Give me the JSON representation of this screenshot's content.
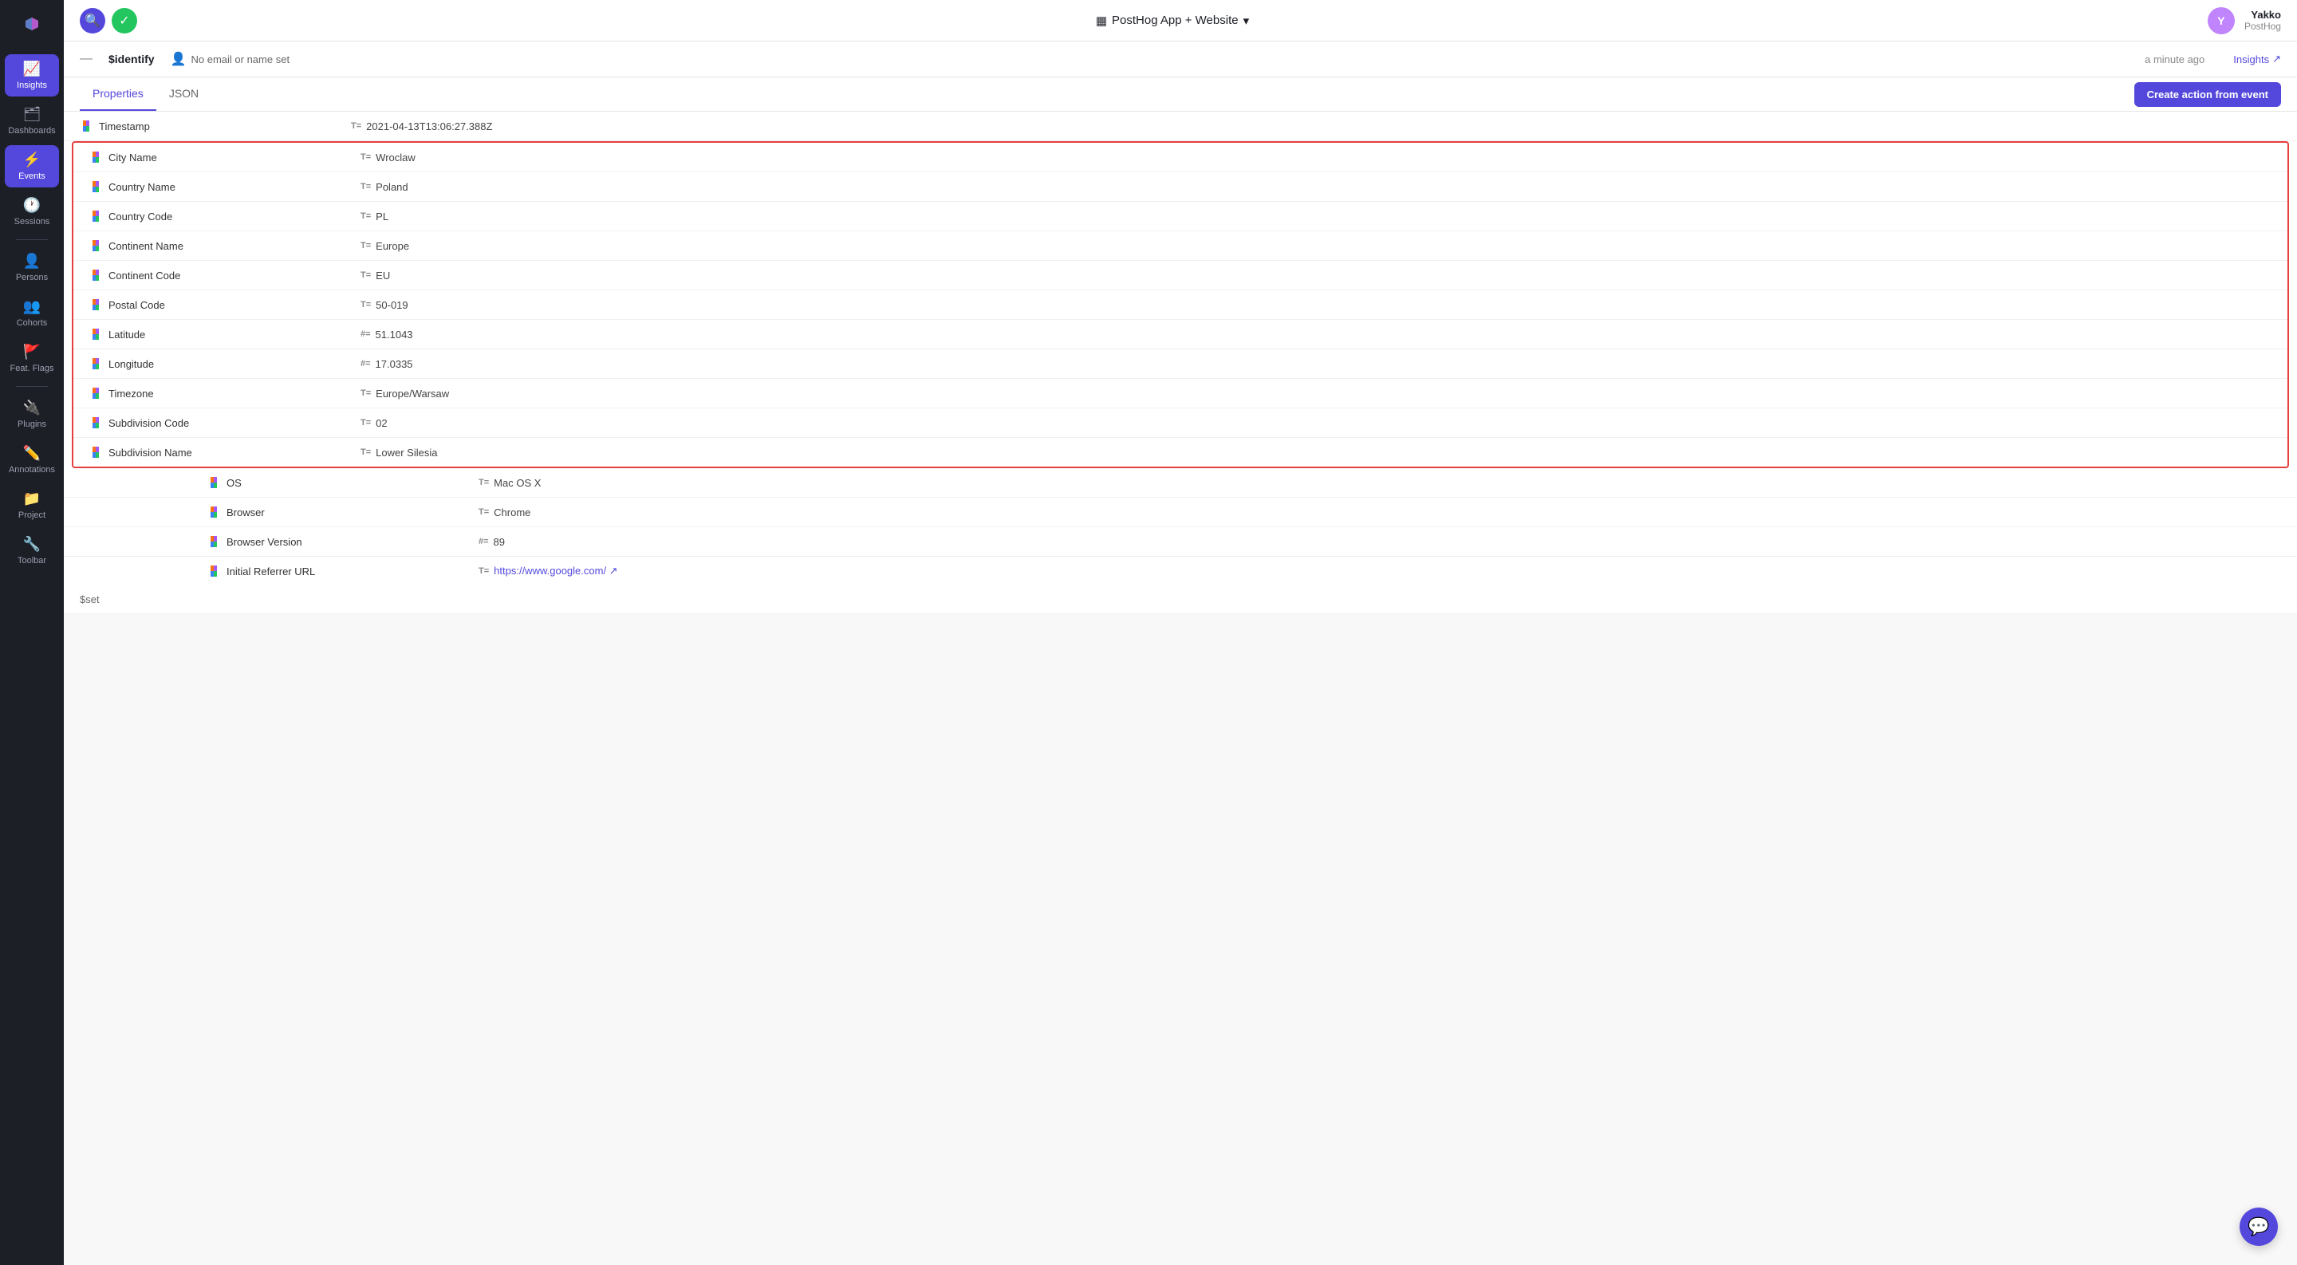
{
  "app": {
    "title": "PostHog App + Website",
    "topbar": {
      "project_name": "PostHog App + Website",
      "user_name": "Yakko",
      "user_org": "PostHog"
    }
  },
  "sidebar": {
    "items": [
      {
        "id": "insights",
        "label": "Insights",
        "icon": "📈",
        "active": false
      },
      {
        "id": "dashboards",
        "label": "Dashboards",
        "icon": "🗂",
        "active": false
      },
      {
        "id": "events",
        "label": "Events",
        "icon": "⚡",
        "active": true
      },
      {
        "id": "sessions",
        "label": "Sessions",
        "icon": "🕐",
        "active": false
      },
      {
        "id": "persons",
        "label": "Persons",
        "icon": "👤",
        "active": false
      },
      {
        "id": "cohorts",
        "label": "Cohorts",
        "icon": "👥",
        "active": false
      },
      {
        "id": "feat-flags",
        "label": "Feat. Flags",
        "icon": "🚩",
        "active": false
      },
      {
        "id": "plugins",
        "label": "Plugins",
        "icon": "🔌",
        "active": false
      },
      {
        "id": "annotations",
        "label": "Annotations",
        "icon": "✏️",
        "active": false
      },
      {
        "id": "project",
        "label": "Project",
        "icon": "📁",
        "active": false
      },
      {
        "id": "toolbar",
        "label": "Toolbar",
        "icon": "🔧",
        "active": false
      }
    ]
  },
  "event": {
    "dash": "—",
    "name": "$identify",
    "user": "No email or name set",
    "time": "a minute ago",
    "insights_label": "Insights"
  },
  "tabs": {
    "items": [
      {
        "id": "properties",
        "label": "Properties",
        "active": true
      },
      {
        "id": "json",
        "label": "JSON",
        "active": false
      }
    ],
    "create_action_label": "Create action from event"
  },
  "properties": {
    "timestamp_row": {
      "key": "Timestamp",
      "value": "2021-04-13T13:06:27.388Z",
      "type": "text"
    },
    "highlighted": [
      {
        "key": "City Name",
        "value": "Wroclaw",
        "type": "text"
      },
      {
        "key": "Country Name",
        "value": "Poland",
        "type": "text"
      },
      {
        "key": "Country Code",
        "value": "PL",
        "type": "text"
      },
      {
        "key": "Continent Name",
        "value": "Europe",
        "type": "text"
      },
      {
        "key": "Continent Code",
        "value": "EU",
        "type": "text"
      },
      {
        "key": "Postal Code",
        "value": "50-019",
        "type": "text"
      },
      {
        "key": "Latitude",
        "value": "51.1043",
        "type": "number"
      },
      {
        "key": "Longitude",
        "value": "17.0335",
        "type": "number"
      },
      {
        "key": "Timezone",
        "value": "Europe/Warsaw",
        "type": "text"
      },
      {
        "key": "Subdivision Code",
        "value": "02",
        "type": "text"
      },
      {
        "key": "Subdivision Name",
        "value": "Lower Silesia",
        "type": "text"
      }
    ],
    "other": [
      {
        "key": "OS",
        "value": "Mac OS X",
        "type": "text"
      },
      {
        "key": "Browser",
        "value": "Chrome",
        "type": "text"
      },
      {
        "key": "Browser Version",
        "value": "89",
        "type": "number"
      },
      {
        "key": "Initial Referrer URL",
        "value": "https://www.google.com/",
        "type": "text",
        "link": true
      }
    ],
    "set_label": "$set"
  },
  "chat_btn_icon": "💬"
}
